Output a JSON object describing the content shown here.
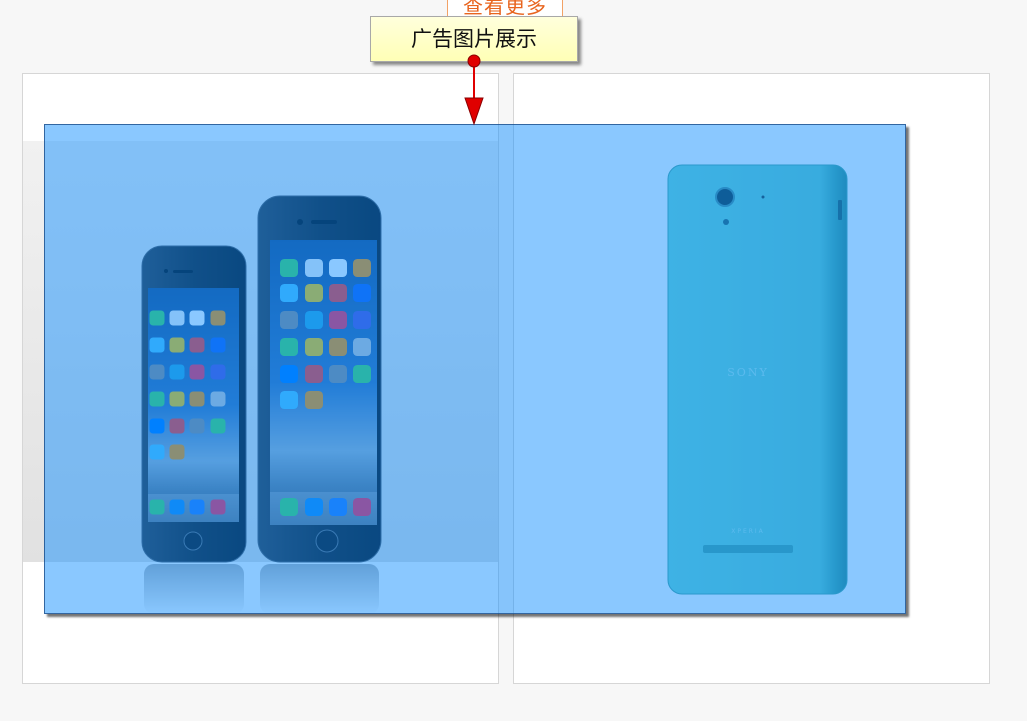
{
  "more_link": {
    "label": "查看更多"
  },
  "annotation": {
    "note_label": "广告图片展示"
  },
  "ad_images": {
    "right_phone": {
      "brand_logo": "SONY",
      "model_logo": "XPERIA"
    }
  },
  "connector": {
    "start": "dot",
    "end": "arrow-head"
  },
  "colors": {
    "page_background": "#f7f7f7",
    "more_link": "#e8651f",
    "more_link_border": "#f2a266",
    "connector": "#e00000",
    "highlight": "#0087ff",
    "card_border": "#d6d6d6"
  }
}
